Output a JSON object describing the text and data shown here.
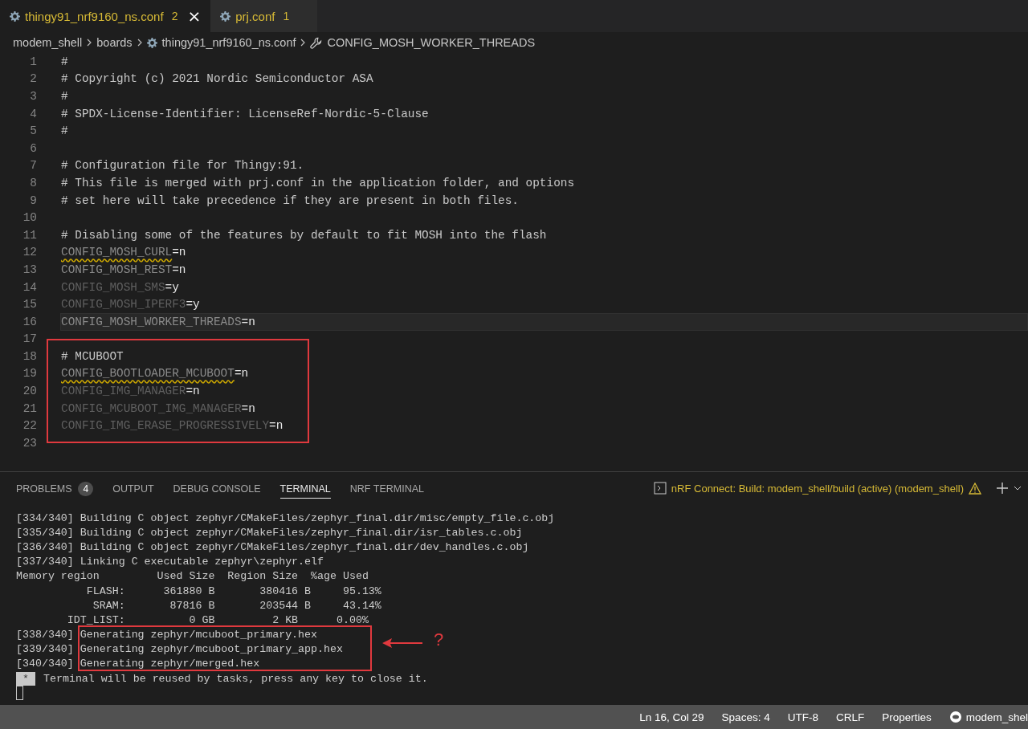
{
  "tabs": [
    {
      "label": "thingy91_nrf9160_ns.conf",
      "count": "2",
      "close": "×",
      "selected": true
    },
    {
      "label": "prj.conf",
      "count": "1",
      "selected": false
    }
  ],
  "breadcrumbs": [
    {
      "label": "modem_shell",
      "kind": "folder"
    },
    {
      "label": "boards",
      "kind": "folder"
    },
    {
      "label": "thingy91_nrf9160_ns.conf",
      "kind": "file"
    },
    {
      "label": "CONFIG_MOSH_WORKER_THREADS",
      "kind": "symbol"
    }
  ],
  "editor": {
    "lines": [
      {
        "number": "1",
        "kind": "comment",
        "text": "#",
        "current": false
      },
      {
        "number": "2",
        "kind": "comment",
        "text": "# Copyright (c) 2021 Nordic Semiconductor ASA",
        "current": false
      },
      {
        "number": "3",
        "kind": "comment",
        "text": "#",
        "current": false
      },
      {
        "number": "4",
        "kind": "comment",
        "text": "# SPDX-License-Identifier: LicenseRef-Nordic-5-Clause",
        "current": false
      },
      {
        "number": "5",
        "kind": "comment",
        "text": "#",
        "current": false
      },
      {
        "number": "6",
        "kind": "blank",
        "current": false
      },
      {
        "number": "7",
        "kind": "comment",
        "text": "# Configuration file for Thingy:91.",
        "current": false
      },
      {
        "number": "8",
        "kind": "comment",
        "text": "# This file is merged with prj.conf in the application folder, and options",
        "current": false
      },
      {
        "number": "9",
        "kind": "comment",
        "text": "# set here will take precedence if they are present in both files.",
        "current": false
      },
      {
        "number": "10",
        "kind": "blank",
        "current": false
      },
      {
        "number": "11",
        "kind": "comment",
        "text": "# Disabling some of the features by default to fit MOSH into the flash",
        "current": false
      },
      {
        "number": "12",
        "kind": "config",
        "key": "CONFIG_MOSH_CURL",
        "value": "=n",
        "dim": false,
        "warning": true,
        "current": false
      },
      {
        "number": "13",
        "kind": "config",
        "key": "CONFIG_MOSH_REST",
        "value": "=n",
        "dim": false,
        "warning": false,
        "current": false
      },
      {
        "number": "14",
        "kind": "config",
        "key": "CONFIG_MOSH_SMS",
        "value": "=y",
        "dim": true,
        "warning": false,
        "current": false
      },
      {
        "number": "15",
        "kind": "config",
        "key": "CONFIG_MOSH_IPERF3",
        "value": "=y",
        "dim": true,
        "warning": false,
        "current": false
      },
      {
        "number": "16",
        "kind": "config",
        "key": "CONFIG_MOSH_WORKER_THREADS",
        "value": "=n",
        "dim": false,
        "warning": false,
        "current": true
      },
      {
        "number": "17",
        "kind": "blank",
        "current": false
      },
      {
        "number": "18",
        "kind": "comment",
        "text": "# MCUBOOT",
        "current": false
      },
      {
        "number": "19",
        "kind": "config",
        "key": "CONFIG_BOOTLOADER_MCUBOOT",
        "value": "=n",
        "dim": false,
        "warning": true,
        "current": false
      },
      {
        "number": "20",
        "kind": "config",
        "key": "CONFIG_IMG_MANAGER",
        "value": "=n",
        "dim": true,
        "warning": false,
        "current": false
      },
      {
        "number": "21",
        "kind": "config",
        "key": "CONFIG_MCUBOOT_IMG_MANAGER",
        "value": "=n",
        "dim": true,
        "warning": false,
        "current": false
      },
      {
        "number": "22",
        "kind": "config",
        "key": "CONFIG_IMG_ERASE_PROGRESSIVELY",
        "value": "=n",
        "dim": true,
        "warning": false,
        "current": false
      },
      {
        "number": "23",
        "kind": "blank",
        "current": false
      }
    ]
  },
  "panel": {
    "tabs": [
      {
        "label": "PROBLEMS",
        "badge": "4",
        "selected": false
      },
      {
        "label": "OUTPUT",
        "selected": false
      },
      {
        "label": "DEBUG CONSOLE",
        "selected": false
      },
      {
        "label": "TERMINAL",
        "selected": true
      },
      {
        "label": "NRF TERMINAL",
        "selected": false
      }
    ],
    "task": "nRF Connect: Build: modem_shell/build (active) (modem_shell)",
    "terminal": {
      "lines": [
        {
          "kind": "plain",
          "text": "[334/340] Building C object zephyr/CMakeFiles/zephyr_final.dir/misc/empty_file.c.obj"
        },
        {
          "kind": "plain",
          "text": "[335/340] Building C object zephyr/CMakeFiles/zephyr_final.dir/isr_tables.c.obj"
        },
        {
          "kind": "plain",
          "text": "[336/340] Building C object zephyr/CMakeFiles/zephyr_final.dir/dev_handles.c.obj"
        },
        {
          "kind": "plain",
          "text": "[337/340] Linking C executable zephyr\\zephyr.elf"
        },
        {
          "kind": "plain",
          "text": "Memory region         Used Size  Region Size  %age Used"
        },
        {
          "kind": "plain",
          "text": "           FLASH:      361880 B       380416 B     95.13%"
        },
        {
          "kind": "plain",
          "text": "            SRAM:       87816 B       203544 B     43.14%"
        },
        {
          "kind": "plain",
          "text": "        IDT_LIST:          0 GB         2 KB      0.00%"
        },
        {
          "kind": "plain",
          "text": "[338/340] Generating zephyr/mcuboot_primary.hex"
        },
        {
          "kind": "plain",
          "text": "[339/340] Generating zephyr/mcuboot_primary_app.hex"
        },
        {
          "kind": "plain",
          "text": "[340/340] Generating zephyr/merged.hex"
        },
        {
          "kind": "notice",
          "badge": "*",
          "text": "Terminal will be reused by tasks, press any key to close it."
        },
        {
          "kind": "cursor"
        }
      ]
    },
    "annotation": {
      "mark": "?"
    }
  },
  "status_bar": [
    "Ln 16, Col 29",
    "Spaces: 4",
    "UTF-8",
    "CRLF",
    "Properties",
    "modem_shel"
  ]
}
